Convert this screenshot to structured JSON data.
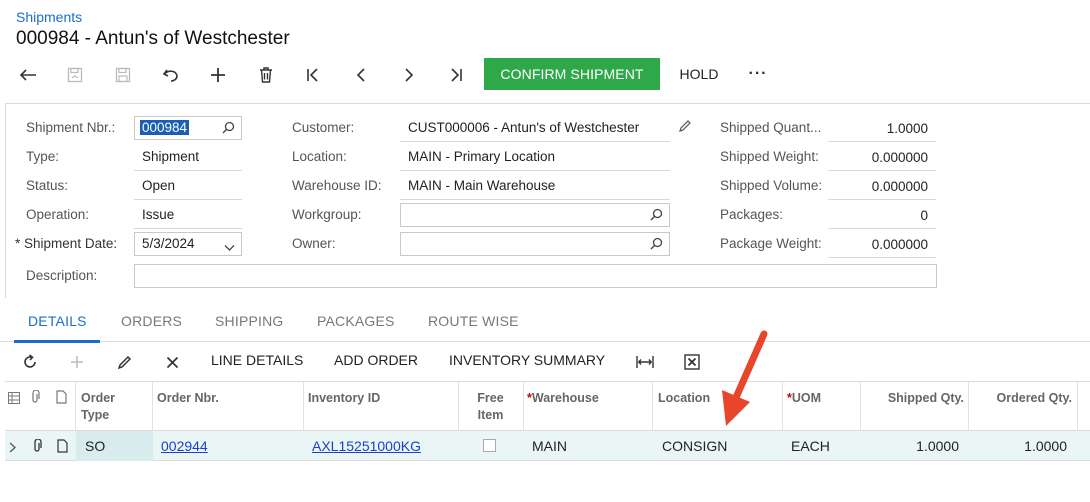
{
  "breadcrumb": "Shipments",
  "title": "000984 - Antun's of Westchester",
  "toolbar": {
    "confirm_label": "CONFIRM SHIPMENT",
    "hold_label": "HOLD",
    "more_label": "···"
  },
  "form": {
    "shipment_nbr_label": "Shipment Nbr.:",
    "shipment_nbr_value": "000984",
    "type_label": "Type:",
    "type_value": "Shipment",
    "status_label": "Status:",
    "status_value": "Open",
    "operation_label": "Operation:",
    "operation_value": "Issue",
    "shipment_date_star": "*",
    "shipment_date_label": "Shipment Date:",
    "shipment_date_value": "5/3/2024",
    "description_label": "Description:",
    "customer_label": "Customer:",
    "customer_value": "CUST000006 - Antun's of Westchester",
    "location_label": "Location:",
    "location_value": "MAIN - Primary Location",
    "warehouse_label": "Warehouse ID:",
    "warehouse_value": "MAIN - Main Warehouse",
    "workgroup_label": "Workgroup:",
    "owner_label": "Owner:",
    "shipped_quant_label": "Shipped Quant...",
    "shipped_quant_value": "1.0000",
    "shipped_weight_label": "Shipped Weight:",
    "shipped_weight_value": "0.000000",
    "shipped_volume_label": "Shipped Volume:",
    "shipped_volume_value": "0.000000",
    "packages_label": "Packages:",
    "packages_value": "0",
    "package_weight_label": "Package Weight:",
    "package_weight_value": "0.000000"
  },
  "tabs": [
    "DETAILS",
    "ORDERS",
    "SHIPPING",
    "PACKAGES",
    "ROUTE WISE"
  ],
  "grid_toolbar": {
    "line_details": "LINE DETAILS",
    "add_order": "ADD ORDER",
    "inventory_summary": "INVENTORY SUMMARY"
  },
  "grid": {
    "headers": {
      "order_type_1": "Order",
      "order_type_2": "Type",
      "order_nbr": "Order Nbr.",
      "inventory_id": "Inventory ID",
      "free_item_1": "Free",
      "free_item_2": "Item",
      "warehouse": "Warehouse",
      "location": "Location",
      "uom": "UOM",
      "shipped_qty": "Shipped Qty.",
      "ordered_qty": "Ordered Qty.",
      "required_marker": "*"
    },
    "rows": [
      {
        "order_type": "SO",
        "order_nbr": "002944",
        "inventory_id": "AXL15251000KG",
        "warehouse": "MAIN",
        "location": "CONSIGN",
        "uom": "EACH",
        "shipped_qty": "1.0000",
        "ordered_qty": "1.0000"
      }
    ]
  },
  "colors": {
    "accent": "#1a6dcc",
    "confirm_button": "#2fa84a",
    "arrow": "#e8462b",
    "row_highlight": "#eaf6f6"
  }
}
